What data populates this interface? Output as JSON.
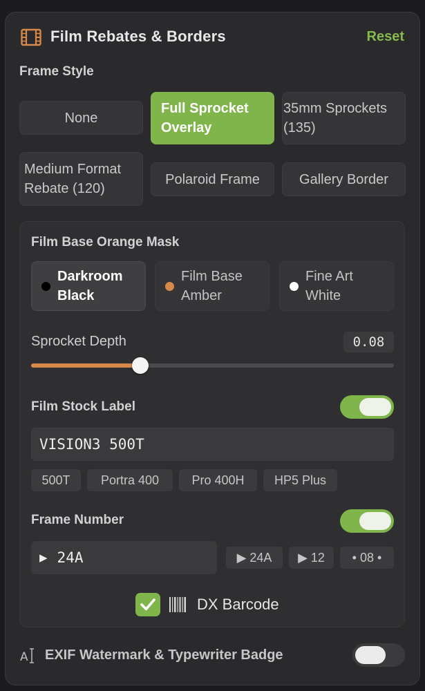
{
  "header": {
    "title": "Film Rebates & Borders",
    "reset_label": "Reset",
    "icon": "film-icon"
  },
  "frame_style": {
    "label": "Frame Style",
    "selected": "Full Sprocket Overlay",
    "options": [
      {
        "line1": "None",
        "line2": ""
      },
      {
        "line1": "Full Sprocket",
        "line2": "Overlay"
      },
      {
        "line1": "35mm Sprockets",
        "line2": "(135)"
      },
      {
        "line1": "Medium Format",
        "line2": "Rebate (120)"
      },
      {
        "line1": "Polaroid Frame",
        "line2": ""
      },
      {
        "line1": "Gallery Border",
        "line2": ""
      }
    ]
  },
  "orange_mask": {
    "label": "Film Base Orange Mask",
    "selected": "Darkroom Black",
    "options": [
      {
        "line1": "Darkroom",
        "line2": "Black",
        "dot_color": "#000000"
      },
      {
        "line1": "Film Base",
        "line2": "Amber",
        "dot_color": "#d7894a"
      },
      {
        "line1": "Fine Art",
        "line2": "White",
        "dot_color": "#ffffff"
      }
    ]
  },
  "sprocket_depth": {
    "label": "Sprocket Depth",
    "value": "0.08",
    "fraction": 0.3
  },
  "film_stock": {
    "label": "Film Stock Label",
    "enabled": true,
    "value": "VISION3 500T",
    "presets": [
      "500T",
      "Portra 400",
      "Pro 400H",
      "HP5 Plus"
    ]
  },
  "frame_number": {
    "label": "Frame Number",
    "enabled": true,
    "value": "24A",
    "presets": [
      "▶ 24A",
      "▶ 12",
      "• 08 •"
    ]
  },
  "dx_barcode": {
    "label": "DX Barcode",
    "checked": true
  },
  "exif": {
    "label": "EXIF Watermark & Typewriter Badge",
    "enabled": false
  },
  "colors": {
    "accent_green": "#7fb54a",
    "slider_orange": "#d7894a",
    "panel_bg": "#2a2a2c"
  }
}
